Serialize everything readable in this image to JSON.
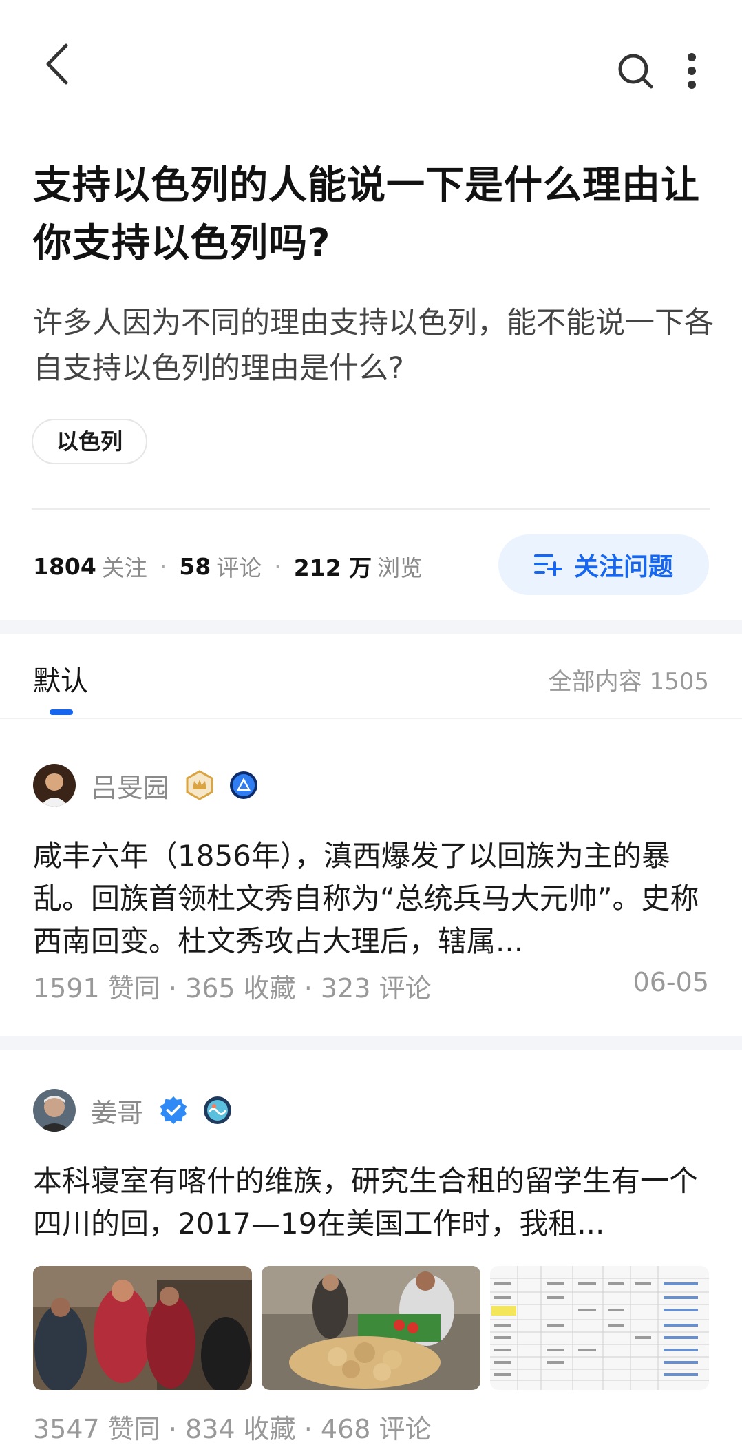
{
  "question": {
    "title": "支持以色列的人能说一下是什么理由让你支持以色列吗?",
    "description": "许多人因为不同的理由支持以色列，能不能说一下各自支持以色列的理由是什么?",
    "tag": "以色列",
    "followers_count": "1804",
    "followers_label": "关注",
    "comments_count": "58",
    "comments_label": "评论",
    "views_count": "212 万",
    "views_label": "浏览",
    "follow_button_label": "关注问题"
  },
  "tabs": {
    "default_label": "默认",
    "total_label": "全部内容 1505"
  },
  "answers": [
    {
      "author": "吕旻园",
      "excerpt": "咸丰六年（1856年），滇西爆发了以回族为主的暴乱。回族首领杜文秀自称为“总统兵马大元帅”。史称西南回变。杜文秀攻占大理后，辖属...",
      "stats": "1591 赞同 · 365 收藏 · 323 评论",
      "date": "06-05"
    },
    {
      "author": "姜哥",
      "excerpt": "本科寝室有喀什的维族，研究生合租的留学生有一个四川的回，2017—19在美国工作时，我租...",
      "stats": "3547 赞同 · 834 收藏 · 468 评论"
    }
  ],
  "icons": {
    "back": "chevron-left-icon",
    "search": "search-icon",
    "more": "more-vertical-icon",
    "follow": "add-list-icon"
  },
  "colors": {
    "accent": "#1766f0",
    "accent_bg": "#ebf3ff",
    "gold_badge": "#d9a441"
  }
}
